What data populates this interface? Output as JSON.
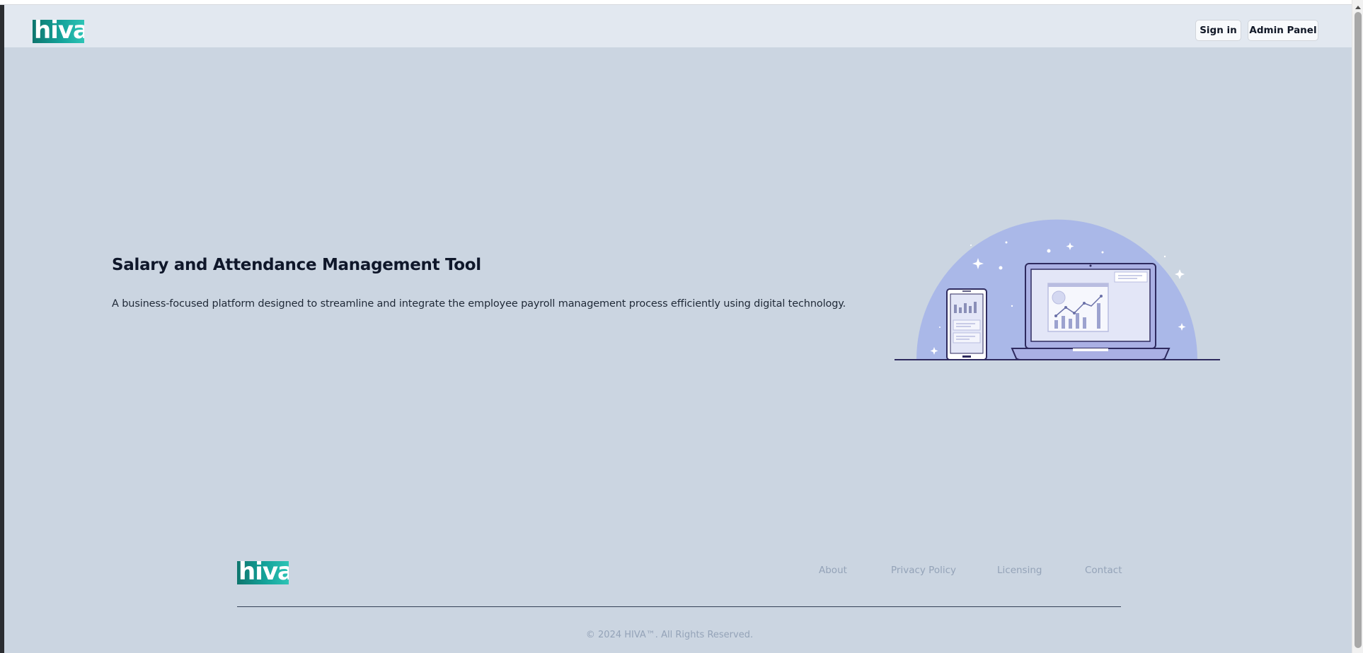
{
  "header": {
    "logo_text": "hiva",
    "signin_label": "Sign in",
    "admin_label": "Admin Panel"
  },
  "hero": {
    "title": "Salary and Attendance Management Tool",
    "description": "A business-focused platform designed to streamline and integrate the employee payroll management process efficiently using digital technology."
  },
  "footer": {
    "logo_text": "hiva",
    "nav": [
      "About",
      "Privacy Policy",
      "Licensing",
      "Contact"
    ],
    "copyright": "© 2024 HIVA™. All Rights Reserved."
  },
  "colors": {
    "page_bg": "#cbd5e1",
    "header_bg": "#e2e8f0",
    "logo_teal": "#14a39a",
    "illustration_blob": "#aab8e8",
    "illustration_stroke": "#2e2a5e"
  },
  "icons": [
    "hiva-logo",
    "phone-illustration",
    "laptop-illustration",
    "sparkle-icon"
  ]
}
